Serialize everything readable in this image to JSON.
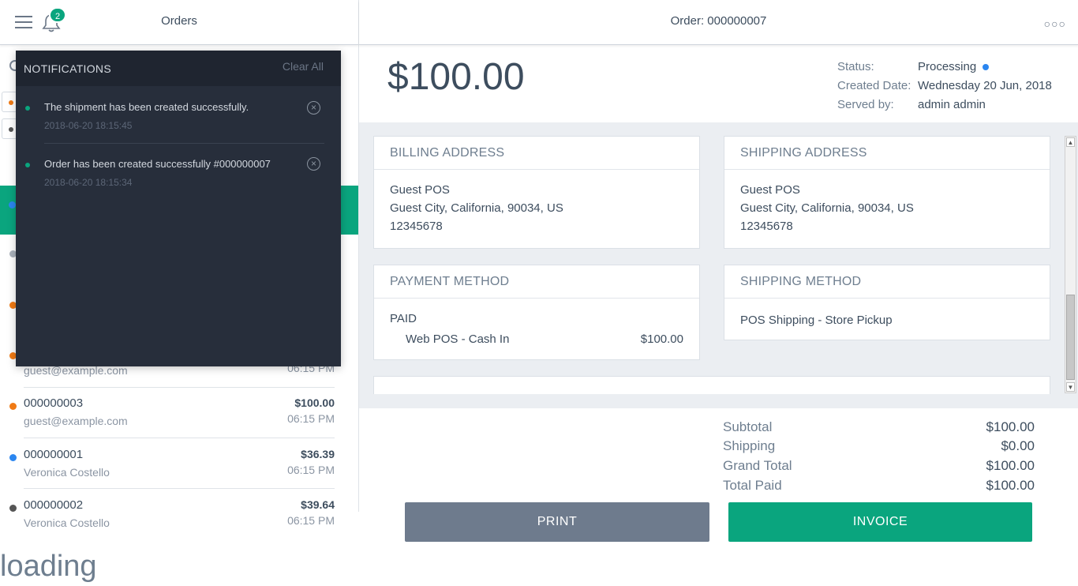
{
  "left_panel": {
    "title": "Orders",
    "notification_count": "2",
    "orders": [
      {
        "number": "",
        "sub": "guest@example.com",
        "amount": "",
        "time": "06:15 PM",
        "dot": "#f07a14"
      },
      {
        "number": "000000003",
        "sub": "guest@example.com",
        "amount": "$100.00",
        "time": "06:15 PM",
        "dot": "#f07a14"
      },
      {
        "number": "000000001",
        "sub": "Veronica Costello",
        "amount": "$36.39",
        "time": "06:15 PM",
        "dot": "#2b86f0"
      },
      {
        "number": "000000002",
        "sub": "Veronica Costello",
        "amount": "$39.64",
        "time": "06:15 PM",
        "dot": "#555555"
      }
    ],
    "loading_text": "loading"
  },
  "notifications": {
    "title": "NOTIFICATIONS",
    "clear_label": "Clear All",
    "items": [
      {
        "message": "The shipment has been created successfully.",
        "time": "2018-06-20 18:15:45"
      },
      {
        "message": "Order has been created successfully #000000007",
        "time": "2018-06-20 18:15:34"
      }
    ]
  },
  "order": {
    "title": "Order: 000000007",
    "amount": "$100.00",
    "status_label": "Status:",
    "status_value": "Processing",
    "created_label": "Created Date:",
    "created_value": "Wednesday 20 Jun, 2018",
    "served_label": "Served by:",
    "served_value": "admin admin"
  },
  "billing": {
    "title": "BILLING ADDRESS",
    "lines": [
      "Guest POS",
      "Guest City, California, 90034, US",
      "12345678"
    ]
  },
  "shipping_address": {
    "title": "SHIPPING ADDRESS",
    "lines": [
      "Guest POS",
      "Guest City, California, 90034, US",
      "12345678"
    ]
  },
  "payment": {
    "title": "PAYMENT METHOD",
    "status": "PAID",
    "method": "Web POS - Cash In",
    "amount": "$100.00"
  },
  "shipping_method": {
    "title": "SHIPPING METHOD",
    "value": "POS Shipping - Store Pickup"
  },
  "totals": {
    "subtotal_label": "Subtotal",
    "subtotal": "$100.00",
    "shipping_label": "Shipping",
    "shipping": "$0.00",
    "grand_label": "Grand Total",
    "grand": "$100.00",
    "paid_label": "Total Paid",
    "paid": "$100.00"
  },
  "actions": {
    "print": "PRINT",
    "invoice": "INVOICE"
  },
  "colors": {
    "accent": "#0aa57e",
    "status_dot": "#2b86f0",
    "print_button": "#6e7b8d"
  }
}
